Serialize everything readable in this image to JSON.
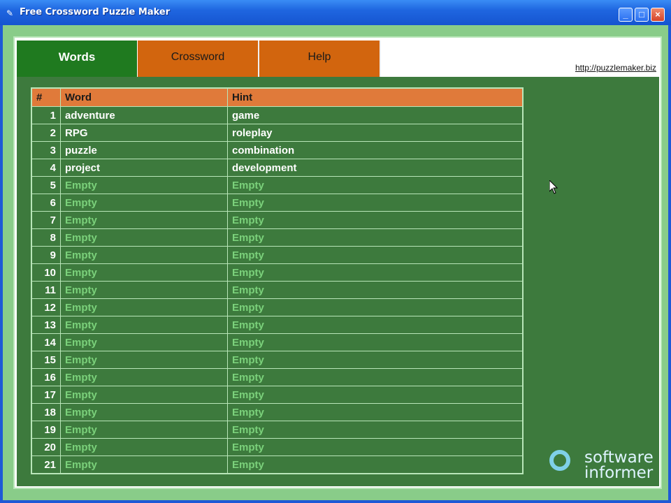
{
  "window": {
    "title": "Free Crossword Puzzle Maker",
    "app_icon": "crossword-app-icon",
    "controls": {
      "minimize": "_",
      "maximize": "□",
      "close": "×"
    }
  },
  "tabs": [
    {
      "label": "Words",
      "active": true
    },
    {
      "label": "Crossword",
      "active": false
    },
    {
      "label": "Help",
      "active": false
    }
  ],
  "site_link": "http://puzzlemaker.biz",
  "table": {
    "headers": {
      "num": "#",
      "word": "Word",
      "hint": "Hint"
    },
    "rows": [
      {
        "num": "1",
        "word": "adventure",
        "hint": "game",
        "empty": false
      },
      {
        "num": "2",
        "word": "RPG",
        "hint": "roleplay",
        "empty": false
      },
      {
        "num": "3",
        "word": "puzzle",
        "hint": "combination",
        "empty": false
      },
      {
        "num": "4",
        "word": "project",
        "hint": "development",
        "empty": false
      },
      {
        "num": "5",
        "word": "Empty",
        "hint": "Empty",
        "empty": true
      },
      {
        "num": "6",
        "word": "Empty",
        "hint": "Empty",
        "empty": true
      },
      {
        "num": "7",
        "word": "Empty",
        "hint": "Empty",
        "empty": true
      },
      {
        "num": "8",
        "word": "Empty",
        "hint": "Empty",
        "empty": true
      },
      {
        "num": "9",
        "word": "Empty",
        "hint": "Empty",
        "empty": true
      },
      {
        "num": "10",
        "word": "Empty",
        "hint": "Empty",
        "empty": true
      },
      {
        "num": "11",
        "word": "Empty",
        "hint": "Empty",
        "empty": true
      },
      {
        "num": "12",
        "word": "Empty",
        "hint": "Empty",
        "empty": true
      },
      {
        "num": "13",
        "word": "Empty",
        "hint": "Empty",
        "empty": true
      },
      {
        "num": "14",
        "word": "Empty",
        "hint": "Empty",
        "empty": true
      },
      {
        "num": "15",
        "word": "Empty",
        "hint": "Empty",
        "empty": true
      },
      {
        "num": "16",
        "word": "Empty",
        "hint": "Empty",
        "empty": true
      },
      {
        "num": "17",
        "word": "Empty",
        "hint": "Empty",
        "empty": true
      },
      {
        "num": "18",
        "word": "Empty",
        "hint": "Empty",
        "empty": true
      },
      {
        "num": "19",
        "word": "Empty",
        "hint": "Empty",
        "empty": true
      },
      {
        "num": "20",
        "word": "Empty",
        "hint": "Empty",
        "empty": true
      },
      {
        "num": "21",
        "word": "Empty",
        "hint": "Empty",
        "empty": true
      }
    ]
  },
  "watermark": {
    "line1": "software",
    "line2": "informer",
    "icon": "software-informer-logo-icon"
  },
  "colors": {
    "active_tab": "#1f7a1f",
    "inactive_tab": "#d2650e",
    "table_header": "#e07a3a",
    "content_bg": "#3d7a3d",
    "empty_text": "#7bd17b"
  }
}
